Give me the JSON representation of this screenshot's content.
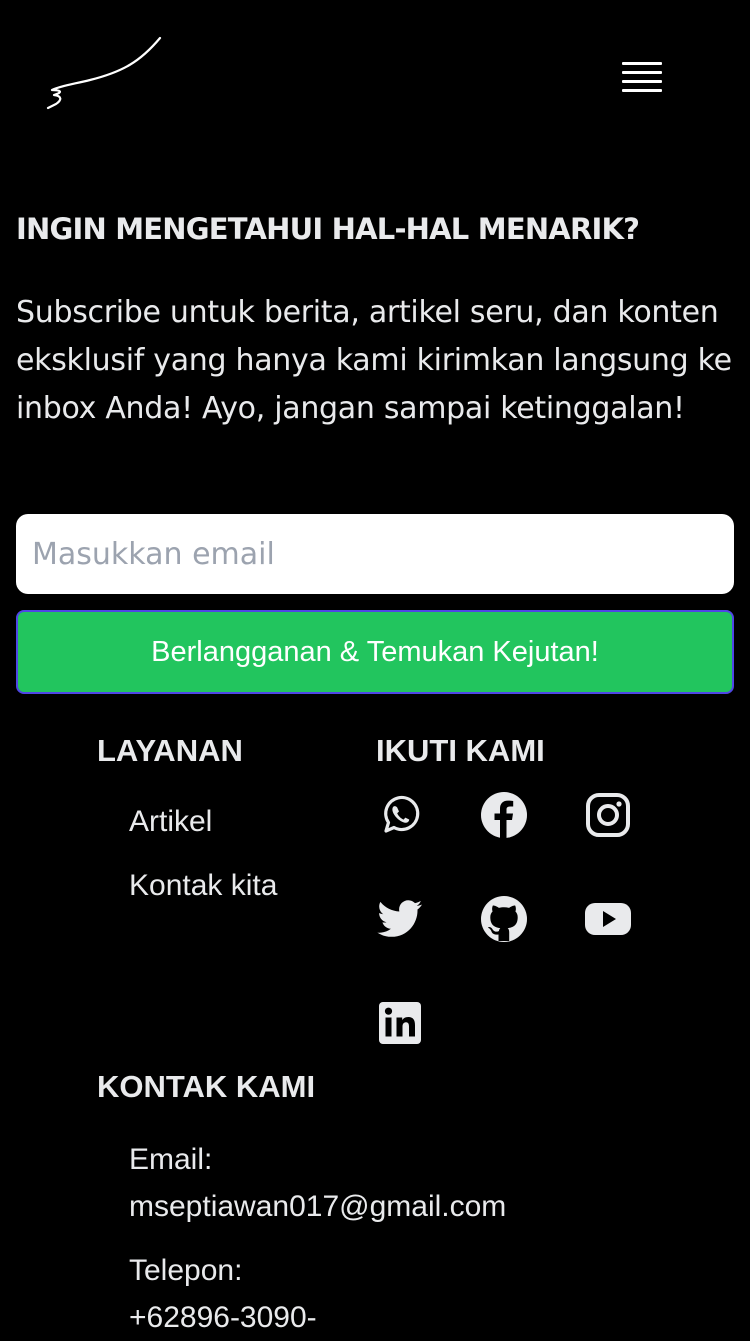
{
  "header": {
    "logo_icon": "signature-logo-icon",
    "menu_icon": "hamburger-menu-icon"
  },
  "newsletter": {
    "heading": "INGIN MENGETAHUI HAL-HAL MENARIK?",
    "description": "Subscribe untuk berita, artikel seru, dan konten eksklusif yang hanya kami kirimkan langsung ke inbox Anda! Ayo, jangan sampai ketinggalan!",
    "email_placeholder": "Masukkan email",
    "email_value": "",
    "button_label": "Berlangganan & Temukan Kejutan!",
    "button_color": "#22c55e"
  },
  "services": {
    "heading": "LAYANAN",
    "links": [
      "Artikel",
      "Kontak kita"
    ]
  },
  "follow": {
    "heading": "IKUTI KAMI",
    "icons": [
      "whatsapp-icon",
      "facebook-icon",
      "instagram-icon",
      "twitter-icon",
      "github-icon",
      "youtube-icon",
      "linkedin-icon"
    ]
  },
  "contact": {
    "heading": "KONTAK KAMI",
    "email_label": "Email:",
    "email": "mseptiawan017@gmail.com",
    "phone_label": "Telepon:",
    "phone": "+62896-3090-"
  },
  "colors": {
    "background": "#000000",
    "text": "#e9eaec",
    "accent_green": "#22c55e",
    "button_border": "#4f46e5"
  }
}
